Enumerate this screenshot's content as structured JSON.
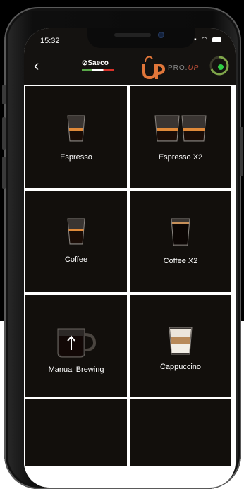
{
  "status_bar": {
    "time": "15:32"
  },
  "header": {
    "back_icon": "chevron-left-icon",
    "brand": "Saeco",
    "logo": "UP",
    "product_prefix": "PRO.",
    "product_suffix": "UP",
    "status_ring_color": "#7fa64a",
    "status_dot_color": "#2fcf45"
  },
  "drinks": [
    {
      "label": "Espresso",
      "icon": "espresso-glass-icon"
    },
    {
      "label": "Espresso X2",
      "icon": "double-espresso-glass-icon"
    },
    {
      "label": "Coffee",
      "icon": "coffee-glass-icon"
    },
    {
      "label": "Coffee X2",
      "icon": "double-coffee-glass-icon"
    },
    {
      "label": "Manual Brewing",
      "icon": "manual-brewing-mug-icon"
    },
    {
      "label": "Cappuccino",
      "icon": "cappuccino-glass-icon"
    }
  ],
  "colors": {
    "tile_background": "#120f0c",
    "app_bar": "#141210",
    "accent_orange": "#e0763a"
  }
}
